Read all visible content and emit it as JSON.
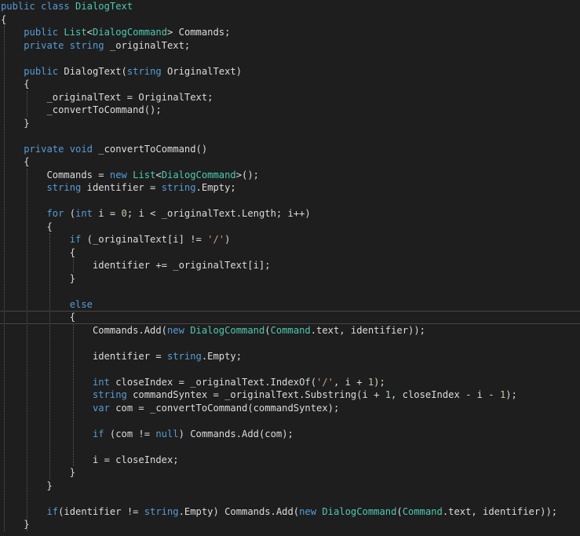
{
  "editor": {
    "background": "#1e1e1e",
    "colors": {
      "keyword": "#569cd6",
      "type": "#4ec9b0",
      "string": "#d69d85",
      "number": "#b5cea8",
      "text": "#dcdcdc"
    },
    "current_line_index": 24,
    "lines": [
      [
        [
          "kw",
          "public"
        ],
        [
          "tx",
          " "
        ],
        [
          "kw",
          "class"
        ],
        [
          "tx",
          " "
        ],
        [
          "ty",
          "DialogText"
        ]
      ],
      [
        [
          "tx",
          "{"
        ]
      ],
      [
        [
          "tx",
          "    "
        ],
        [
          "kw",
          "public"
        ],
        [
          "tx",
          " "
        ],
        [
          "ty",
          "List"
        ],
        [
          "tx",
          "<"
        ],
        [
          "ty",
          "DialogCommand"
        ],
        [
          "tx",
          "> Commands;"
        ]
      ],
      [
        [
          "tx",
          "    "
        ],
        [
          "kw",
          "private"
        ],
        [
          "tx",
          " "
        ],
        [
          "kw",
          "string"
        ],
        [
          "tx",
          " _originalText;"
        ]
      ],
      [],
      [
        [
          "tx",
          "    "
        ],
        [
          "kw",
          "public"
        ],
        [
          "tx",
          " DialogText("
        ],
        [
          "kw",
          "string"
        ],
        [
          "tx",
          " OriginalText)"
        ]
      ],
      [
        [
          "tx",
          "    {"
        ]
      ],
      [
        [
          "tx",
          "        _originalText = OriginalText;"
        ]
      ],
      [
        [
          "tx",
          "        _convertToCommand();"
        ]
      ],
      [
        [
          "tx",
          "    }"
        ]
      ],
      [],
      [
        [
          "tx",
          "    "
        ],
        [
          "kw",
          "private"
        ],
        [
          "tx",
          " "
        ],
        [
          "kw",
          "void"
        ],
        [
          "tx",
          " _convertToCommand()"
        ]
      ],
      [
        [
          "tx",
          "    {"
        ]
      ],
      [
        [
          "tx",
          "        Commands = "
        ],
        [
          "kw",
          "new"
        ],
        [
          "tx",
          " "
        ],
        [
          "ty",
          "List"
        ],
        [
          "tx",
          "<"
        ],
        [
          "ty",
          "DialogCommand"
        ],
        [
          "tx",
          ">();"
        ]
      ],
      [
        [
          "tx",
          "        "
        ],
        [
          "kw",
          "string"
        ],
        [
          "tx",
          " identifier = "
        ],
        [
          "kw",
          "string"
        ],
        [
          "tx",
          ".Empty;"
        ]
      ],
      [],
      [
        [
          "tx",
          "        "
        ],
        [
          "kw",
          "for"
        ],
        [
          "tx",
          " ("
        ],
        [
          "kw",
          "int"
        ],
        [
          "tx",
          " i = "
        ],
        [
          "nm",
          "0"
        ],
        [
          "tx",
          "; i < _originalText.Length; i++)"
        ]
      ],
      [
        [
          "tx",
          "        {"
        ]
      ],
      [
        [
          "tx",
          "            "
        ],
        [
          "kw",
          "if"
        ],
        [
          "tx",
          " (_originalText[i] != "
        ],
        [
          "st",
          "'/'"
        ],
        [
          "tx",
          ")"
        ]
      ],
      [
        [
          "tx",
          "            {"
        ]
      ],
      [
        [
          "tx",
          "                identifier += _originalText[i];"
        ]
      ],
      [
        [
          "tx",
          "            }"
        ]
      ],
      [],
      [
        [
          "tx",
          "            "
        ],
        [
          "kw",
          "else"
        ]
      ],
      [
        [
          "tx",
          "            {"
        ]
      ],
      [
        [
          "tx",
          "                Commands.Add("
        ],
        [
          "kw",
          "new"
        ],
        [
          "tx",
          " "
        ],
        [
          "ty",
          "DialogCommand"
        ],
        [
          "tx",
          "("
        ],
        [
          "ty",
          "Command"
        ],
        [
          "tx",
          ".text, identifier));"
        ]
      ],
      [],
      [
        [
          "tx",
          "                identifier = "
        ],
        [
          "kw",
          "string"
        ],
        [
          "tx",
          ".Empty;"
        ]
      ],
      [],
      [
        [
          "tx",
          "                "
        ],
        [
          "kw",
          "int"
        ],
        [
          "tx",
          " closeIndex = _originalText.IndexOf("
        ],
        [
          "st",
          "'/'"
        ],
        [
          "tx",
          ", i + "
        ],
        [
          "nm",
          "1"
        ],
        [
          "tx",
          ");"
        ]
      ],
      [
        [
          "tx",
          "                "
        ],
        [
          "kw",
          "string"
        ],
        [
          "tx",
          " commandSyntex = _originalText.Substring(i + "
        ],
        [
          "nm",
          "1"
        ],
        [
          "tx",
          ", closeIndex - i - "
        ],
        [
          "nm",
          "1"
        ],
        [
          "tx",
          ");"
        ]
      ],
      [
        [
          "tx",
          "                "
        ],
        [
          "kw",
          "var"
        ],
        [
          "tx",
          " com = _convertToCommand(commandSyntex);"
        ]
      ],
      [],
      [
        [
          "tx",
          "                "
        ],
        [
          "kw",
          "if"
        ],
        [
          "tx",
          " (com != "
        ],
        [
          "kw",
          "null"
        ],
        [
          "tx",
          ") Commands.Add(com);"
        ]
      ],
      [],
      [
        [
          "tx",
          "                i = closeIndex;"
        ]
      ],
      [
        [
          "tx",
          "            }"
        ]
      ],
      [
        [
          "tx",
          "        }"
        ]
      ],
      [],
      [
        [
          "tx",
          "        "
        ],
        [
          "kw",
          "if"
        ],
        [
          "tx",
          "(identifier != "
        ],
        [
          "kw",
          "string"
        ],
        [
          "tx",
          ".Empty) Commands.Add("
        ],
        [
          "kw",
          "new"
        ],
        [
          "tx",
          " "
        ],
        [
          "ty",
          "DialogCommand"
        ],
        [
          "tx",
          "("
        ],
        [
          "ty",
          "Command"
        ],
        [
          "tx",
          ".text, identifier));"
        ]
      ],
      [
        [
          "tx",
          "    }"
        ]
      ]
    ]
  }
}
